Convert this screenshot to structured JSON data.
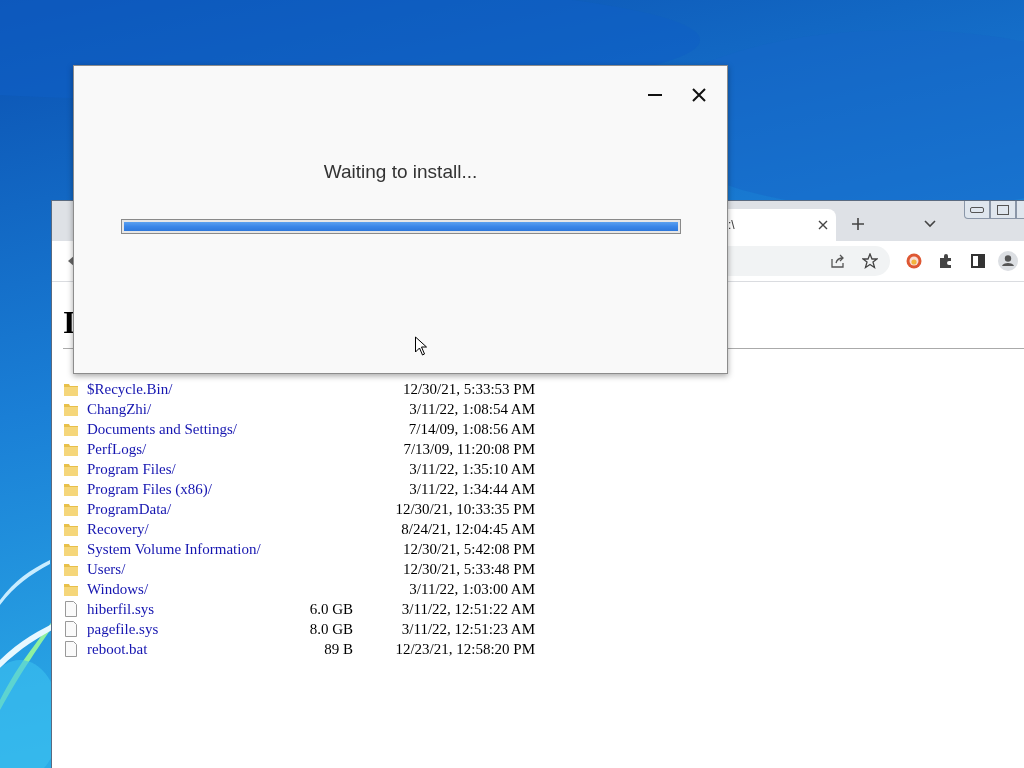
{
  "browser": {
    "tab": {
      "title": ":\\"
    },
    "heading": "I",
    "listing": [
      {
        "kind": "folder",
        "name": "$Recycle.Bin/",
        "date": "12/30/21, 5:33:53 PM"
      },
      {
        "kind": "folder",
        "name": "ChangZhi/",
        "date": "3/11/22, 1:08:54 AM"
      },
      {
        "kind": "folder",
        "name": "Documents and Settings/",
        "date": "7/14/09, 1:08:56 AM"
      },
      {
        "kind": "folder",
        "name": "PerfLogs/",
        "date": "7/13/09, 11:20:08 PM"
      },
      {
        "kind": "folder",
        "name": "Program Files/",
        "date": "3/11/22, 1:35:10 AM"
      },
      {
        "kind": "folder",
        "name": "Program Files (x86)/",
        "date": "3/11/22, 1:34:44 AM"
      },
      {
        "kind": "folder",
        "name": "ProgramData/",
        "date": "12/30/21, 10:33:35 PM"
      },
      {
        "kind": "folder",
        "name": "Recovery/",
        "date": "8/24/21, 12:04:45 AM"
      },
      {
        "kind": "folder",
        "name": "System Volume Information/",
        "date": "12/30/21, 5:42:08 PM"
      },
      {
        "kind": "folder",
        "name": "Users/",
        "date": "12/30/21, 5:33:48 PM"
      },
      {
        "kind": "folder",
        "name": "Windows/",
        "date": "3/11/22, 1:03:00 AM"
      },
      {
        "kind": "file",
        "name": "hiberfil.sys",
        "size": "6.0 GB",
        "date": "3/11/22, 12:51:22 AM"
      },
      {
        "kind": "file",
        "name": "pagefile.sys",
        "size": "8.0 GB",
        "date": "3/11/22, 12:51:23 AM"
      },
      {
        "kind": "file",
        "name": "reboot.bat",
        "size": "89 B",
        "date": "12/23/21, 12:58:20 PM"
      }
    ]
  },
  "dialog": {
    "title": "Waiting to install...",
    "progress": {
      "level": 1
    }
  }
}
